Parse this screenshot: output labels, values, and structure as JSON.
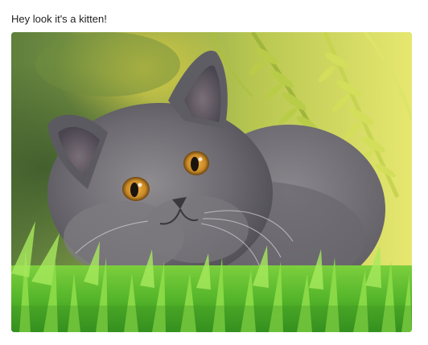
{
  "message": {
    "text": "Hey look it's a kitten!"
  },
  "image": {
    "subject": "kitten",
    "alt": "kitten-photo"
  },
  "colors": {
    "background": "#ffffff",
    "text": "#1f1f1f"
  }
}
